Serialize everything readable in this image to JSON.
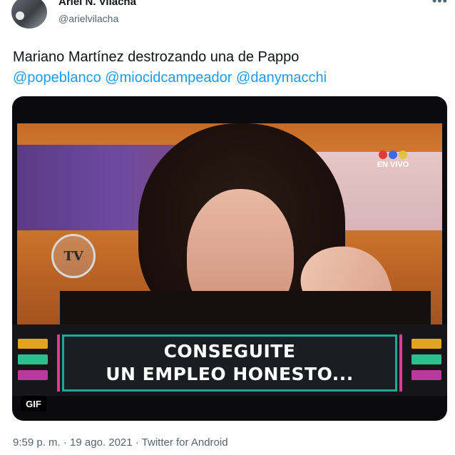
{
  "author": {
    "name": "Ariel N. Vilacha",
    "handle": "@arielvilacha"
  },
  "tweet": {
    "text": "Mariano Martínez destrozando una de Pappo",
    "mentions": [
      "@popeblanco",
      "@miocidcampeador",
      "@danymacchi"
    ]
  },
  "media": {
    "type_badge": "GIF",
    "channel_logo": "TV",
    "live_bug": "EN VIVO",
    "caption_line1": "CONSEGUITE",
    "caption_line2": "UN EMPLEO HONESTO..."
  },
  "meta": {
    "timestamp": "9:59 p. m. · 19 ago. 2021 · Twitter for Android"
  },
  "colors": {
    "mention": "#1d9bf0",
    "caption_border": "#1fa89a",
    "caption_accent": "#e23a8f"
  }
}
